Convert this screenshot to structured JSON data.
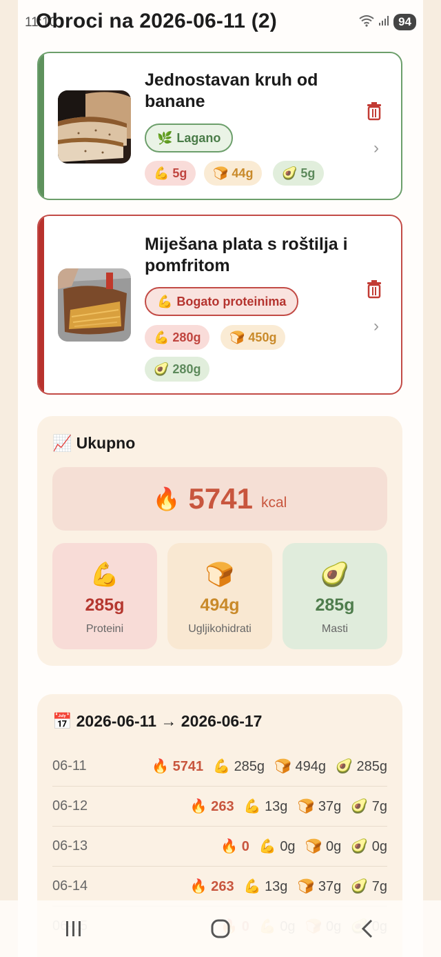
{
  "status": {
    "time": "11:10",
    "battery": "94"
  },
  "title": "Obroci na 2026-06-11 (2)",
  "meals": [
    {
      "name": "Jednostavan kruh od banane",
      "tag_icon": "🌿",
      "tag": "Lagano",
      "protein": "5g",
      "carbs": "44g",
      "fat": "5g"
    },
    {
      "name": "Miješana plata s roštilja i pomfritom",
      "tag_icon": "💪",
      "tag": "Bogato proteinima",
      "protein": "280g",
      "carbs": "450g",
      "fat": "280g"
    }
  ],
  "emoji": {
    "protein": "💪",
    "carbs": "🍞",
    "fat": "🥑",
    "fire": "🔥",
    "chart": "📈",
    "calendar": "📅"
  },
  "totals": {
    "title": "Ukupno",
    "kcal": "5741",
    "kcal_unit": "kcal",
    "protein": {
      "value": "285g",
      "label": "Proteini"
    },
    "carbs": {
      "value": "494g",
      "label": "Ugljikohidrati"
    },
    "fat": {
      "value": "285g",
      "label": "Masti"
    }
  },
  "week": {
    "title": "2026-06-11 → 2026-06-17",
    "rows": [
      {
        "date": "06-11",
        "kcal": "5741",
        "p": "285g",
        "c": "494g",
        "f": "285g"
      },
      {
        "date": "06-12",
        "kcal": "263",
        "p": "13g",
        "c": "37g",
        "f": "7g"
      },
      {
        "date": "06-13",
        "kcal": "0",
        "p": "0g",
        "c": "0g",
        "f": "0g"
      },
      {
        "date": "06-14",
        "kcal": "263",
        "p": "13g",
        "c": "37g",
        "f": "7g"
      },
      {
        "date": "06-15",
        "kcal": "0",
        "p": "0g",
        "c": "0g",
        "f": "0g"
      }
    ]
  },
  "colors": {
    "accent_red": "#c8563e",
    "green": "#5e925d",
    "red": "#b8322d",
    "background": "#f7ede0"
  }
}
